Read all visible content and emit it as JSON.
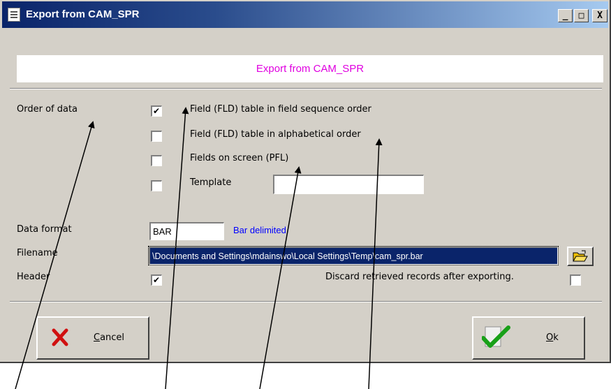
{
  "window": {
    "title": "Export from CAM_SPR",
    "minimize_glyph": "_",
    "maximize_glyph": "□",
    "close_glyph": "X"
  },
  "banner": {
    "text": "Export from CAM_SPR"
  },
  "order_of_data": {
    "label": "Order of data",
    "options": [
      {
        "label": "Field (FLD) table in field sequence order",
        "checked": true
      },
      {
        "label": "Field (FLD) table in alphabetical order",
        "checked": false
      },
      {
        "label": "Fields on screen (PFL)",
        "checked": false
      },
      {
        "label": "Template",
        "checked": false
      }
    ],
    "template_value": ""
  },
  "data_format": {
    "label": "Data format",
    "value": "BAR",
    "description": "Bar delimited"
  },
  "filename": {
    "label": "Filename",
    "value": "\\Documents and Settings\\mdainswo\\Local Settings\\Temp\\cam_spr.bar"
  },
  "header": {
    "label": "Header",
    "checked": true
  },
  "discard": {
    "label": "Discard retrieved records after exporting.",
    "checked": false
  },
  "buttons": {
    "cancel": {
      "label_first": "C",
      "label_rest": "ancel"
    },
    "ok": {
      "label_first": "O",
      "label_rest": "k"
    }
  },
  "colors": {
    "banner_text": "#e000e0",
    "format_description": "#0000ff",
    "face": "#d4d0c8",
    "title_bar": "#0a246a"
  },
  "icons": {
    "title": "document-icon",
    "browse": "folder-open-icon",
    "cancel": "red-x-icon",
    "ok": "green-check-icon"
  }
}
